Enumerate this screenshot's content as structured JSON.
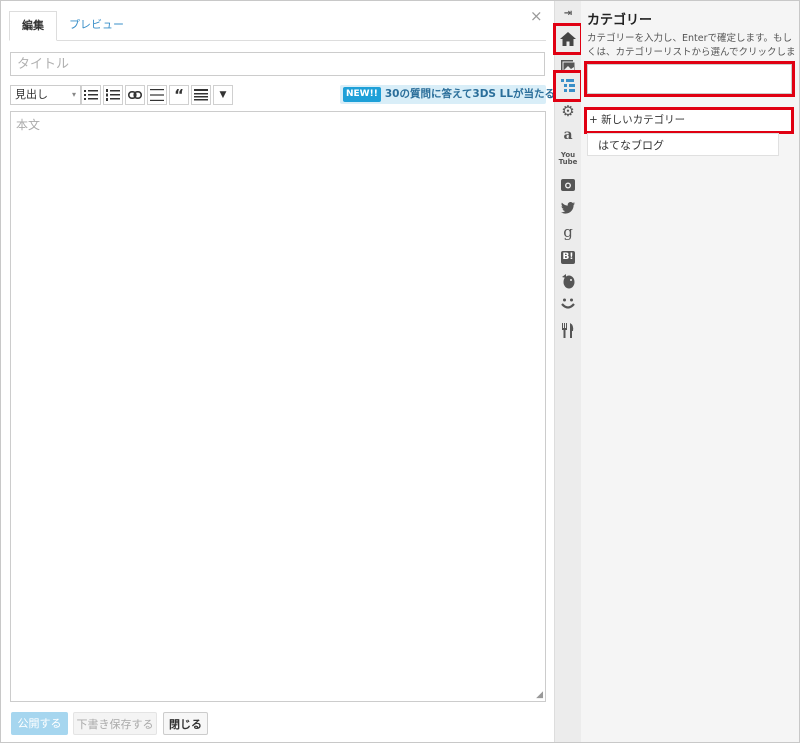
{
  "editor": {
    "tabs": [
      {
        "label": "編集",
        "active": true
      },
      {
        "label": "プレビュー",
        "active": false
      }
    ],
    "close_symbol": "×",
    "title_placeholder": "タイトル",
    "heading_select": "見出し",
    "toolbar_icons": [
      "bulleted-list-icon",
      "numbered-list-icon",
      "link-icon",
      "more-separator-icon",
      "quote-icon",
      "table-of-contents-icon",
      "expand-toolbar-icon"
    ],
    "promo": {
      "badge": "NEW!!",
      "text": "30の質問に答えて3DS LLが当たる！"
    },
    "body_placeholder": "本文",
    "buttons": {
      "publish": "公開する",
      "draft": "下書き保存する",
      "close": "閉じる"
    }
  },
  "iconbar": {
    "items": [
      "collapse-arrow-icon",
      "home-icon",
      "photo-icon",
      "category-icon",
      "settings-icon",
      "amazon-icon",
      "youtube-icon",
      "instagram-icon",
      "twitter-icon",
      "google-icon",
      "hatena-bookmark-icon",
      "evernote-icon",
      "smile-icon",
      "restaurant-icon"
    ],
    "labels": {
      "youtube": "You\nTube",
      "hatena": "B!",
      "google": "g",
      "amazon": "a"
    }
  },
  "panel": {
    "title": "カテゴリー",
    "description": "カテゴリーを入力し、Enterで確定します。もしくは、カテゴリーリストから選んでクリックします。",
    "new_category": "+ 新しいカテゴリー",
    "categories": [
      "はてなブログ"
    ]
  },
  "colors": {
    "highlight": "#e00012",
    "link": "#3a8fc8",
    "promo_bg": "#d9eef8"
  }
}
